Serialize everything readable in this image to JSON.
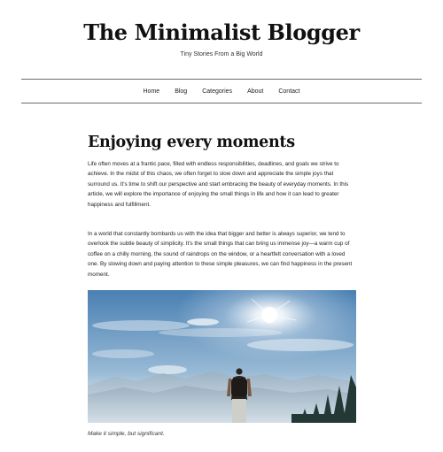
{
  "site": {
    "title": "The Minimalist Blogger",
    "tagline": "Tiny Stories From a Big World"
  },
  "nav": {
    "items": [
      {
        "label": "Home"
      },
      {
        "label": "Blog"
      },
      {
        "label": "Categories"
      },
      {
        "label": "About"
      },
      {
        "label": "Contact"
      }
    ]
  },
  "post": {
    "title": "Enjoying every moments",
    "paragraph_1": "Life often moves at a frantic pace, filled with endless responsibilities, deadlines, and goals we strive to achieve. In the midst of this chaos, we often forget to slow down and appreciate the simple joys that surround us. It's time to shift our perspective and start embracing the beauty of everyday moments. In this article, we will explore the importance of enjoying the small things in life and how it can lead to greater happiness and fulfillment.",
    "paragraph_2": "In a world that constantly bombards us with the idea that bigger and better is always superior, we tend to overlook the subtle beauty of simplicity. It's the small things that can bring us immense joy—a warm cup of coffee on a chilly morning, the sound of raindrops on the window, or a heartfelt conversation with a loved one. By slowing down and paying attention to these simple pleasures, we can find happiness in the present moment.",
    "image_caption": "Make it simple, but significant."
  },
  "colors": {
    "sky_top": "#4f86b8",
    "sky_bottom": "#c9dbe8",
    "mountains": "#7f98ab",
    "trees": "#243a38"
  }
}
